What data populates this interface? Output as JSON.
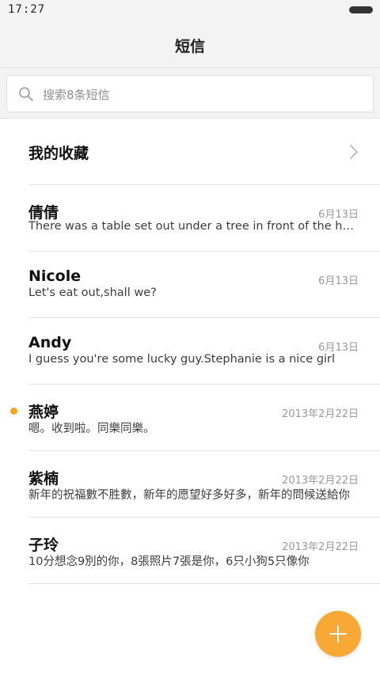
{
  "status_bar": {
    "time": "17:27",
    "battery_icon": "battery-icon"
  },
  "header": {
    "title": "短信"
  },
  "search": {
    "placeholder": "搜索8条短信",
    "icon": "search-icon"
  },
  "favorites": {
    "label": "我的收藏",
    "icon": "chevron-right-icon"
  },
  "messages": [
    {
      "name": "倩倩",
      "date": "6月13日",
      "preview": "There was a table set out under a tree in front of the house",
      "unread": false
    },
    {
      "name": "Nicole",
      "date": "6月13日",
      "preview": "Let's eat out,shall we?",
      "unread": false
    },
    {
      "name": "Andy",
      "date": "6月13日",
      "preview": "I guess you're some lucky guy.Stephanie is a nice girl",
      "unread": false
    },
    {
      "name": "燕婷",
      "date": "2013年2月22日",
      "preview": "嗯。收到啦。同樂同樂。",
      "unread": true
    },
    {
      "name": "紫楠",
      "date": "2013年2月22日",
      "preview": "新年的祝福數不胜數，新年的愿望好多好多，新年的問候送給你",
      "unread": false
    },
    {
      "name": "子玲",
      "date": "2013年2月22日",
      "preview": "10分想念9別的你，8張照片7張是你，6只小狗5只像你",
      "unread": false
    }
  ],
  "fab": {
    "icon": "plus-icon"
  },
  "colors": {
    "accent": "#f8a935",
    "unread_dot": "#f5a623",
    "header_bg": "#f3f3f3",
    "date_text": "#9a9a9a"
  }
}
